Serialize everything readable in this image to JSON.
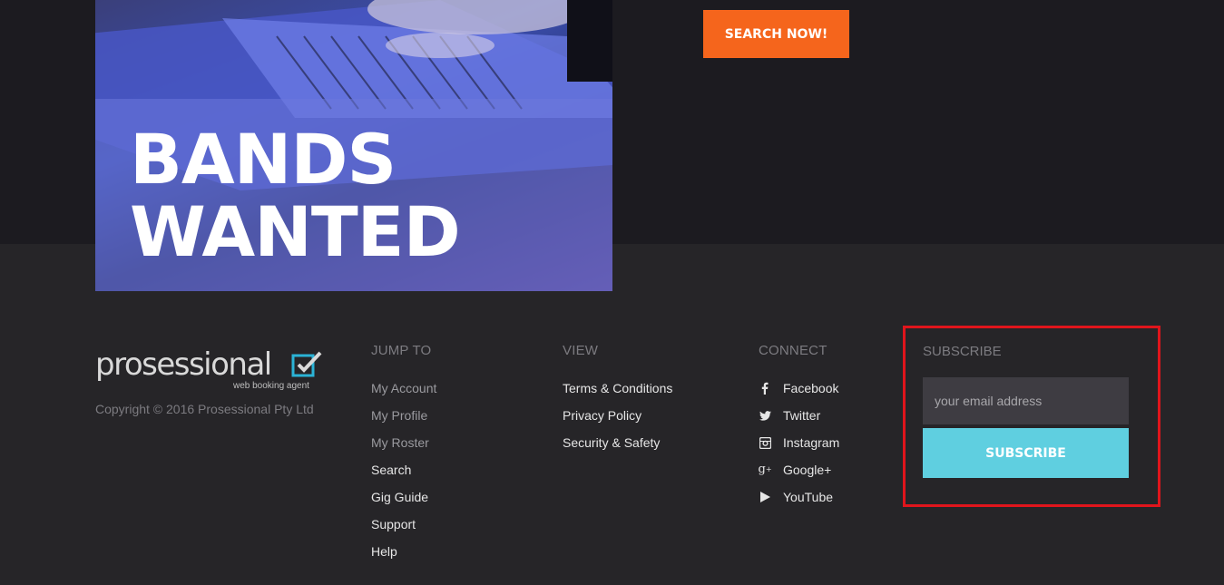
{
  "banner": {
    "headline": "BANDS\nWANTED"
  },
  "search": {
    "button_label": "SEARCH NOW!"
  },
  "brand": {
    "logo_word": "prosessional",
    "logo_tag": "web booking agent",
    "copyright": "Copyright © 2016 Prosessional Pty Ltd",
    "accent": "#2bb3d6"
  },
  "footer": {
    "jump_to": {
      "title": "JUMP TO",
      "items": [
        "My Account",
        "My Profile",
        "My Roster",
        "Search",
        "Gig Guide",
        "Support",
        "Help"
      ]
    },
    "view": {
      "title": "VIEW",
      "items": [
        "Terms & Conditions",
        "Privacy Policy",
        "Security & Safety"
      ]
    },
    "connect": {
      "title": "CONNECT",
      "items": [
        {
          "label": "Facebook",
          "icon": "facebook-icon"
        },
        {
          "label": "Twitter",
          "icon": "twitter-icon"
        },
        {
          "label": "Instagram",
          "icon": "instagram-icon"
        },
        {
          "label": "Google+",
          "icon": "google-plus-icon"
        },
        {
          "label": "YouTube",
          "icon": "youtube-icon"
        }
      ]
    },
    "subscribe": {
      "title": "SUBSCRIBE",
      "placeholder": "your email address",
      "button_label": "SUBSCRIBE"
    }
  },
  "colors": {
    "page_bg": "#262528",
    "top_band": "#1c1b20",
    "search_button": "#f5651c",
    "subscribe_button": "#5fcfe0",
    "highlight_border": "#e0151c"
  }
}
